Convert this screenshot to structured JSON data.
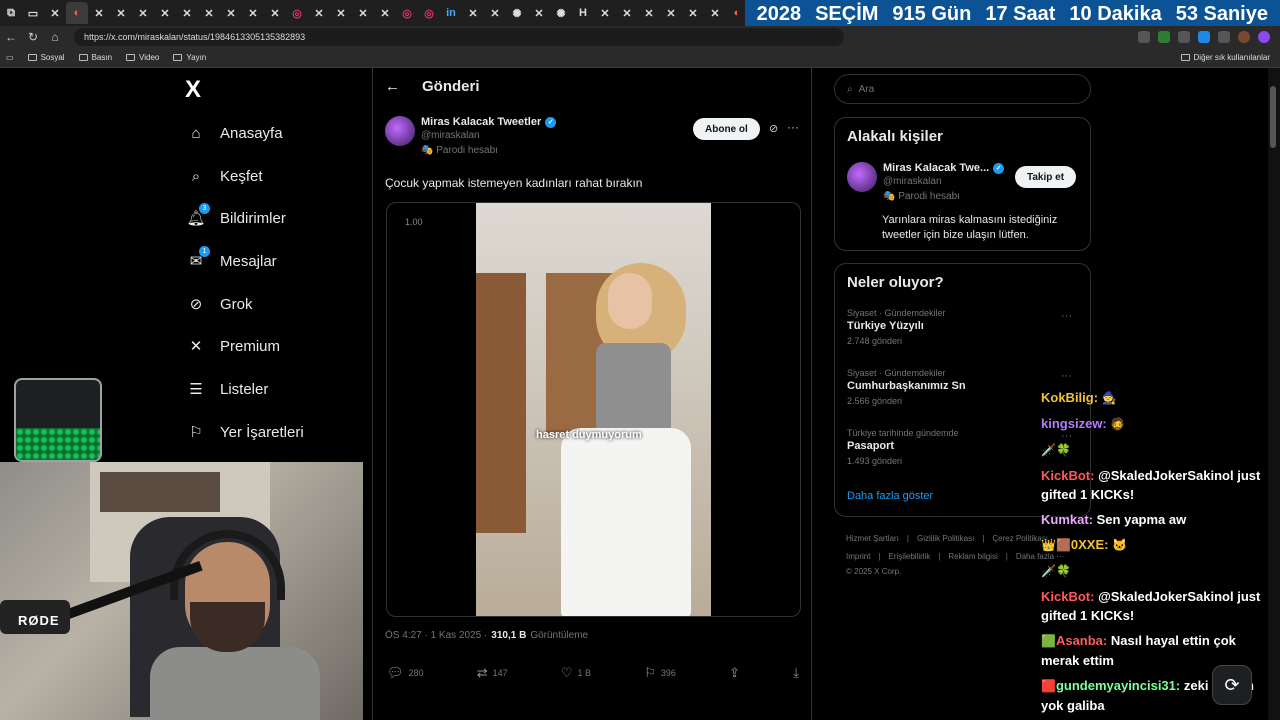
{
  "browser": {
    "url": "https://x.com/miraskalan/status/1984613305135382893",
    "tabs": [
      "⧉",
      "▭",
      "✕",
      "◐",
      "✕",
      "✕",
      "✕",
      "✕",
      "✕",
      "✕",
      "✕",
      "✕",
      "✕",
      "◎",
      "✕",
      "✕",
      "✕",
      "✕",
      "◎",
      "◎",
      "in",
      "✕",
      "✕",
      "✺",
      "✕",
      "✺",
      "H",
      "✕",
      "✕",
      "✕",
      "✕",
      "✕",
      "✕",
      "◐",
      "✕"
    ],
    "bookmarks": [
      "Sosyal",
      "Basın",
      "Video",
      "Yayın"
    ],
    "bookmarks_right": "Diğer sık kullanılanlar"
  },
  "countdown": {
    "year": "2028",
    "label": "SEÇİM",
    "days": "915 Gün",
    "hours": "17 Saat",
    "minutes": "10 Dakika",
    "seconds": "53 Saniye"
  },
  "nav": {
    "logo": "X",
    "items": [
      {
        "label": "Anasayfa",
        "icon": "home-icon"
      },
      {
        "label": "Keşfet",
        "icon": "search-icon"
      },
      {
        "label": "Bildirimler",
        "icon": "bell-icon",
        "badge": "3"
      },
      {
        "label": "Mesajlar",
        "icon": "mail-icon",
        "badge": "1"
      },
      {
        "label": "Grok",
        "icon": "grok-icon"
      },
      {
        "label": "Premium",
        "icon": "x-icon"
      },
      {
        "label": "Listeler",
        "icon": "list-icon"
      },
      {
        "label": "Yer İşaretleri",
        "icon": "bookmark-icon"
      }
    ]
  },
  "post": {
    "header": "Gönderi",
    "author_name": "Miras Kalacak Tweetler",
    "handle": "@miraskalan",
    "parody": "Parodi hesabı",
    "follow": "Abone ol",
    "text": "Çocuk yapmak istemeyen kadınları rahat bırakın",
    "speed": "1.00",
    "subtitle": "hasret duymuyorum",
    "time": "ÖS 4:27 · 1 Kas 2025 ·",
    "views": "310,1 B",
    "views_label": "Görüntüleme",
    "replies": "280",
    "reposts": "147",
    "likes": "1 B",
    "bookmarks": "396"
  },
  "sidebar": {
    "search_placeholder": "Ara",
    "relevant_title": "Alakalı kişiler",
    "rel_name": "Miras Kalacak Twe...",
    "rel_handle": "@miraskalan",
    "rel_parody": "Parodi hesabı",
    "rel_follow": "Takip et",
    "rel_bio": "Yarınlara miras kalmasını istediğiniz tweetler için bize ulaşın lütfen.",
    "trends_title": "Neler oluyor?",
    "trends": [
      {
        "category": "Siyaset · Gündemdekiler",
        "name": "Türkiye Yüzyılı",
        "count": "2.748 gönderi"
      },
      {
        "category": "Siyaset · Gündemdekiler",
        "name": "Cumhurbaşkanımız Sn",
        "count": "2.566 gönderi"
      },
      {
        "category": "Türkiye tarihinde gündemde",
        "name": "Pasaport",
        "count": "1.493 gönderi"
      }
    ],
    "show_more": "Daha fazla göster",
    "footer_row1": [
      "Hizmet Şartları",
      "|",
      "Gizlilik Politikası",
      "|",
      "Çerez Politikası"
    ],
    "footer_row2": [
      "Imprint",
      "|",
      "Erişilebilirlik",
      "|",
      "Reklam bilgisi",
      "|",
      "Daha fazla ···"
    ],
    "copyright": "© 2025 X Corp."
  },
  "webcam": {
    "mic_brand": "RØDE"
  },
  "chat": [
    {
      "user": "KokBilig:",
      "text": "",
      "emoji": "🧙",
      "cls": "user"
    },
    {
      "user": "kingsizew:",
      "text": "",
      "emoji": "🧔",
      "cls": "u-purple"
    },
    {
      "user": "",
      "text": "",
      "emoji": "🗡️🍀",
      "cls": "user"
    },
    {
      "user": "KickBot:",
      "text": "@SkaledJokerSakinol just gifted 1 KICKs!",
      "emoji": "",
      "cls": "u-red"
    },
    {
      "user": "Kumkat:",
      "text": "Sen yapma aw",
      "emoji": "",
      "cls": "u-pink"
    },
    {
      "user": "0XXE:",
      "text": "",
      "emoji": "🐱",
      "cls": "user",
      "pre": "👑🟫"
    },
    {
      "user": "",
      "text": "",
      "emoji": "🗡️🍀",
      "cls": "user"
    },
    {
      "user": "KickBot:",
      "text": "@SkaledJokerSakinol just gifted 1 KICKs!",
      "emoji": "",
      "cls": "u-red"
    },
    {
      "user": "Asanba:",
      "text": "Nasıl hayal ettin çok merak ettim",
      "emoji": "",
      "cls": "u-red",
      "pre": "🟩"
    },
    {
      "user": "gundemyayincisi31:",
      "text": "zeki sarışın yok galiba",
      "emoji": "",
      "cls": "u-green",
      "pre": "🟥"
    }
  ]
}
